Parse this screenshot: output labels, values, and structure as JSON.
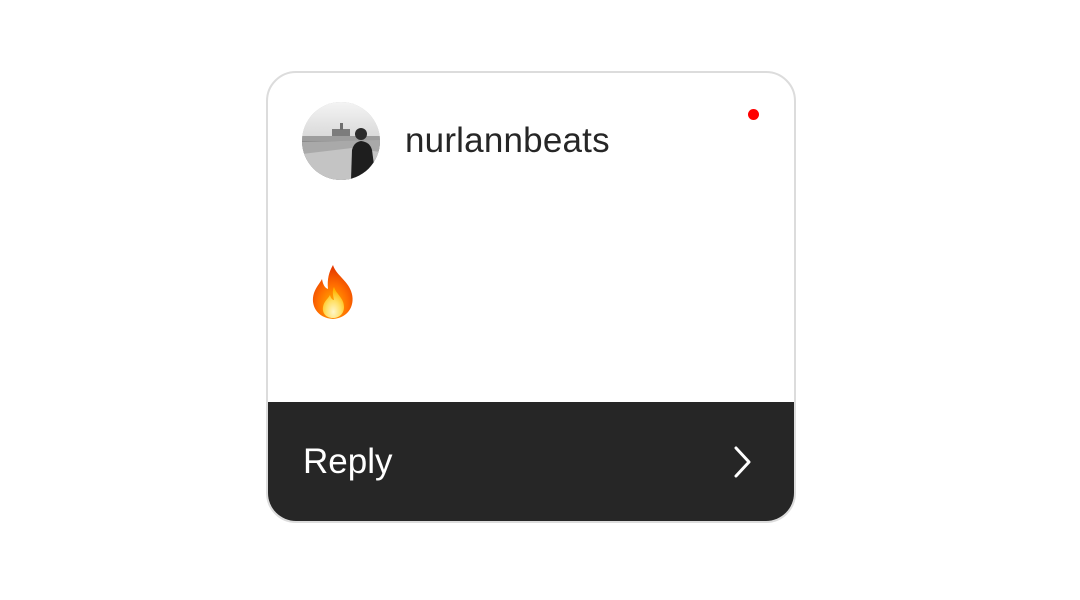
{
  "notification": {
    "username": "nurlannbeats",
    "avatar_icon": "profile-photo",
    "unread_indicator_color": "#ff0000",
    "message_icon": "fire-emoji",
    "reply_label": "Reply",
    "reply_icon": "chevron-right-icon"
  },
  "colors": {
    "card_background": "#ffffff",
    "card_border": "#dcdcdc",
    "footer_background": "#262626",
    "username_text": "#262626",
    "reply_text": "#ffffff"
  }
}
